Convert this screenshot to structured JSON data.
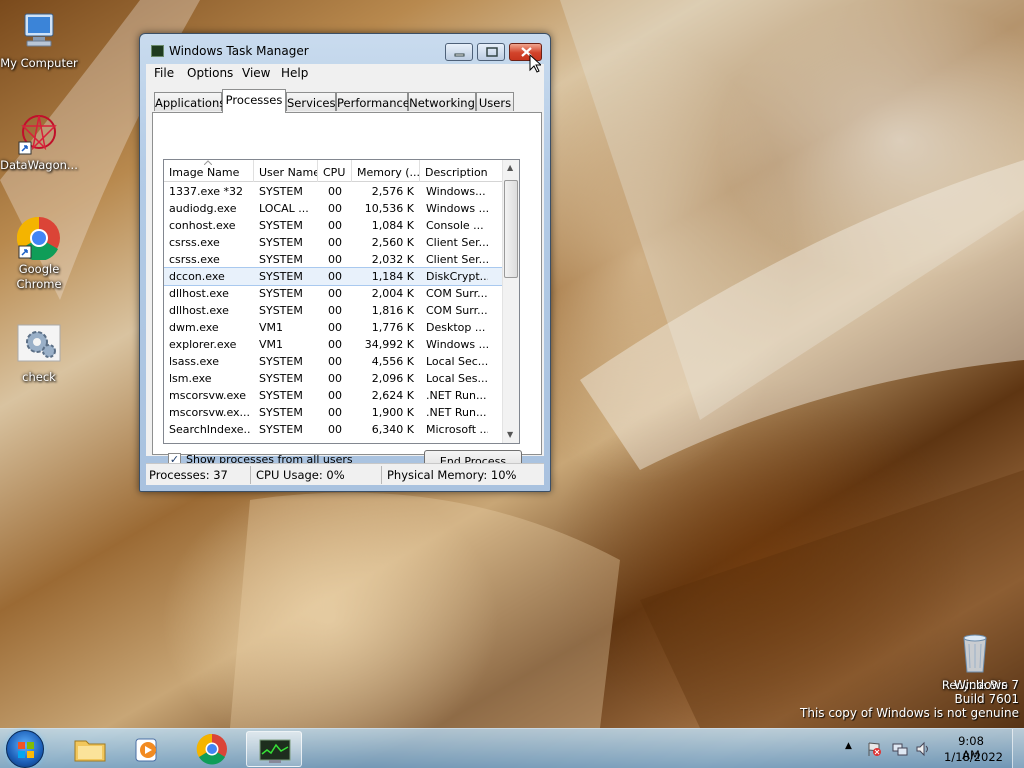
{
  "desktop": {
    "icons": [
      {
        "label": "My Computer"
      },
      {
        "label": "DataWagon..."
      },
      {
        "label": "Google Chrome"
      },
      {
        "label": "check"
      },
      {
        "label": "Recycle Bin"
      }
    ],
    "watermark": {
      "line1": "Windows 7",
      "line2": "Build 7601",
      "line3": "This copy of Windows is not genuine"
    }
  },
  "window": {
    "title": "Windows Task Manager",
    "menu": [
      "File",
      "Options",
      "View",
      "Help"
    ],
    "tabs": [
      "Applications",
      "Processes",
      "Services",
      "Performance",
      "Networking",
      "Users"
    ],
    "active_tab": "Processes",
    "columns": [
      "Image Name",
      "User Name",
      "CPU",
      "Memory (...",
      "Description"
    ],
    "processes": [
      {
        "name": "1337.exe *32",
        "user": "SYSTEM",
        "cpu": "00",
        "mem": "2,576 K",
        "desc": "Windows..."
      },
      {
        "name": "audiodg.exe",
        "user": "LOCAL ...",
        "cpu": "00",
        "mem": "10,536 K",
        "desc": "Windows ..."
      },
      {
        "name": "conhost.exe",
        "user": "SYSTEM",
        "cpu": "00",
        "mem": "1,084 K",
        "desc": "Console ..."
      },
      {
        "name": "csrss.exe",
        "user": "SYSTEM",
        "cpu": "00",
        "mem": "2,560 K",
        "desc": "Client Ser..."
      },
      {
        "name": "csrss.exe",
        "user": "SYSTEM",
        "cpu": "00",
        "mem": "2,032 K",
        "desc": "Client Ser..."
      },
      {
        "name": "dccon.exe",
        "user": "SYSTEM",
        "cpu": "00",
        "mem": "1,184 K",
        "desc": "DiskCrypt..."
      },
      {
        "name": "dllhost.exe",
        "user": "SYSTEM",
        "cpu": "00",
        "mem": "2,004 K",
        "desc": "COM Surr..."
      },
      {
        "name": "dllhost.exe",
        "user": "SYSTEM",
        "cpu": "00",
        "mem": "1,816 K",
        "desc": "COM Surr..."
      },
      {
        "name": "dwm.exe",
        "user": "VM1",
        "cpu": "00",
        "mem": "1,776 K",
        "desc": "Desktop ..."
      },
      {
        "name": "explorer.exe",
        "user": "VM1",
        "cpu": "00",
        "mem": "34,992 K",
        "desc": "Windows ..."
      },
      {
        "name": "lsass.exe",
        "user": "SYSTEM",
        "cpu": "00",
        "mem": "4,556 K",
        "desc": "Local Sec..."
      },
      {
        "name": "lsm.exe",
        "user": "SYSTEM",
        "cpu": "00",
        "mem": "2,096 K",
        "desc": "Local Ses..."
      },
      {
        "name": "mscorsvw.exe",
        "user": "SYSTEM",
        "cpu": "00",
        "mem": "2,624 K",
        "desc": ".NET Run..."
      },
      {
        "name": "mscorsvw.ex...",
        "user": "SYSTEM",
        "cpu": "00",
        "mem": "1,900 K",
        "desc": ".NET Run..."
      },
      {
        "name": "SearchIndexe...",
        "user": "SYSTEM",
        "cpu": "00",
        "mem": "6,340 K",
        "desc": "Microsoft ..."
      }
    ],
    "selected_process": "dccon.exe",
    "show_all_label": "Show processes from all users",
    "show_all_checked": "✓",
    "end_process_label": "End Process",
    "status": {
      "processes": "Processes: 37",
      "cpu": "CPU Usage: 0%",
      "memory": "Physical Memory: 10%"
    }
  },
  "taskbar": {
    "time": "9:08 AM",
    "date": "1/18/2022"
  }
}
